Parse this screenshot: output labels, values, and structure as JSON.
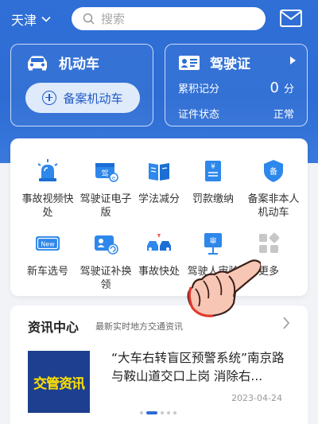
{
  "header": {
    "city": "天津",
    "search_placeholder": "搜索",
    "icons": [
      "chevron-down-icon",
      "search-icon",
      "mail-icon"
    ]
  },
  "vehicle_card": {
    "title": "机动车",
    "register_button": "备案机动车",
    "icon": "car-icon"
  },
  "license_card": {
    "title": "驾驶证",
    "points_label": "累积记分",
    "points_value": "0",
    "points_unit": "分",
    "status_label": "证件状态",
    "status_value": "正常",
    "icon": "id-card-icon"
  },
  "services": [
    {
      "label": "事故视频快处",
      "icon": "siren-icon"
    },
    {
      "label": "驾驶证电子版",
      "icon": "e-license-icon"
    },
    {
      "label": "学法减分",
      "icon": "book-icon"
    },
    {
      "label": "罚款缴纳",
      "icon": "payment-icon"
    },
    {
      "label": "备案非本人机动车",
      "icon": "shield-icon"
    },
    {
      "label": "新车选号",
      "icon": "new-plate-icon"
    },
    {
      "label": "驾驶证补换领",
      "icon": "license-replace-icon"
    },
    {
      "label": "事故快处",
      "icon": "car-accident-icon"
    },
    {
      "label": "驾驶人审验",
      "icon": "review-icon"
    },
    {
      "label": "更多",
      "icon": "more-icon"
    }
  ],
  "news": {
    "title": "资讯中心",
    "subtitle": "最新实时地方交通资讯",
    "thumb_text": "交管资讯",
    "headline": "“大车右转盲区预警系统”南京路与鞍山道交口上岗 消除右...",
    "date": "2023-04-24"
  },
  "colors": {
    "primary": "#2c6cd4",
    "thumb_bg": "#1e3f8f",
    "thumb_text": "#ffe100"
  }
}
